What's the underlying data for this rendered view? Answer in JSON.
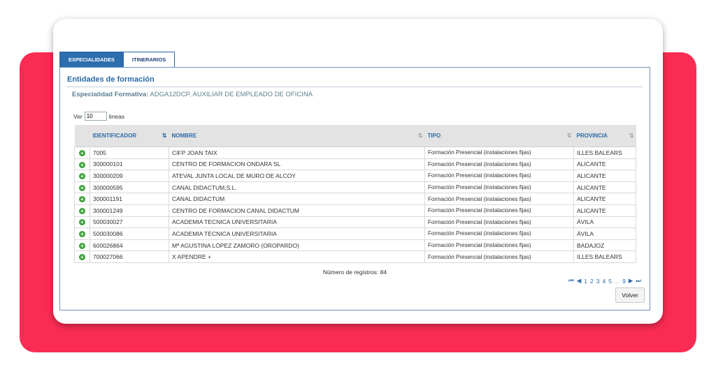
{
  "tabs": [
    {
      "label": "ESPECIALIDADES"
    },
    {
      "label": "ITINERARIOS"
    }
  ],
  "panel": {
    "title": "Entidades de formación",
    "subtitle_label": "Especialidad Formativa:",
    "subtitle_value": "ADGA12DCP, AUXILIAR DE EMPLEADO DE OFICINA"
  },
  "page_size": {
    "prefix": "Ver",
    "value": "10",
    "suffix": "lineas"
  },
  "table": {
    "headers": {
      "identificador": "IDENTIFICADOR",
      "nombre": "NOMBRE",
      "tipo": "TIPO",
      "provincia": "PROVINCIA"
    },
    "rows": [
      {
        "id": "7005",
        "nombre": "CIFP JOAN TAIX",
        "tipo": "Formación Presencial (instalaciones fijas)",
        "provincia": "ILLES BALEARS"
      },
      {
        "id": "300000101",
        "nombre": "CENTRO DE FORMACION ONDARA SL",
        "tipo": "Formación Presencial (instalaciones fijas)",
        "provincia": "ALICANTE"
      },
      {
        "id": "300000209",
        "nombre": "ATEVAL JUNTA LOCAL DE MURO DE ALCOY",
        "tipo": "Formación Presencial (instalaciones fijas)",
        "provincia": "ALICANTE"
      },
      {
        "id": "300000595",
        "nombre": "CANAL DIDACTUM,S.L.",
        "tipo": "Formación Presencial (instalaciones fijas)",
        "provincia": "ALICANTE"
      },
      {
        "id": "300001191",
        "nombre": "CANAL DIDACTUM",
        "tipo": "Formación Presencial (instalaciones fijas)",
        "provincia": "ALICANTE"
      },
      {
        "id": "300001249",
        "nombre": "CENTRO DE FORMACION CANAL DIDACTUM",
        "tipo": "Formación Presencial (instalaciones fijas)",
        "provincia": "ALICANTE"
      },
      {
        "id": "500030027",
        "nombre": "ACADEMIA TECNICA UNIVERSITARIA",
        "tipo": "Formación Presencial (instalaciones fijas)",
        "provincia": "ÁVILA"
      },
      {
        "id": "500030086",
        "nombre": "ACADEMIA TECNICA UNIVERSITARIA",
        "tipo": "Formación Presencial (instalaciones fijas)",
        "provincia": "ÁVILA"
      },
      {
        "id": "600026864",
        "nombre": "Mª AGUSTINA LÓPEZ ZAMORO (OROPARDO)",
        "tipo": "Formación Presencial (instalaciones fijas)",
        "provincia": "BADAJOZ"
      },
      {
        "id": "700027066",
        "nombre": "X APENDRE +",
        "tipo": "Formación Presencial (instalaciones fijas)",
        "provincia": "ILLES BALEARS"
      }
    ]
  },
  "records_text": "Número de registros: 84",
  "pagination": {
    "first": "⏮",
    "prev": "◀",
    "pages": [
      "1",
      "2",
      "3",
      "4",
      "5"
    ],
    "ellipsis": "...",
    "last_page": "9",
    "next": "▶",
    "last": "⏭"
  },
  "volver_label": "Volver",
  "colors": {
    "background_accent": "#fb2c54",
    "tab_active": "#2c6dae",
    "header_text": "#2b6aa6",
    "add_icon": "#3ea23e"
  }
}
